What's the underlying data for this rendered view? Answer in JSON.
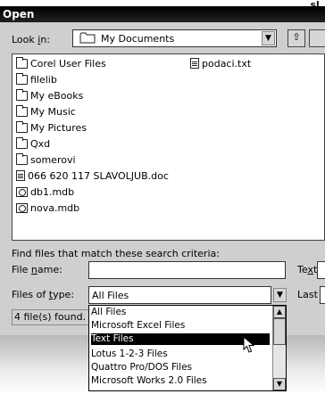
{
  "corner_text": "sl.",
  "window": {
    "title": "Open"
  },
  "look_in": {
    "label_pre": "Look ",
    "label_u": "i",
    "label_post": "n:",
    "value": "My Documents",
    "icon": "folder-icon"
  },
  "toolbar": {
    "up_icon": "up-folder-icon",
    "up_glyph": "⇧"
  },
  "files": [
    {
      "name": "Corel User Files",
      "icon": "folder-icon"
    },
    {
      "name": "filelib",
      "icon": "folder-icon"
    },
    {
      "name": "My eBooks",
      "icon": "folder-icon"
    },
    {
      "name": "My Music",
      "icon": "folder-icon"
    },
    {
      "name": "My Pictures",
      "icon": "folder-icon"
    },
    {
      "name": "Qxd",
      "icon": "folder-icon"
    },
    {
      "name": "somerovi",
      "icon": "folder-icon"
    },
    {
      "name": "066 620 117  SLAVOLJUB.doc",
      "icon": "word-doc-icon"
    },
    {
      "name": "db1.mdb",
      "icon": "access-db-icon"
    },
    {
      "name": "nova.mdb",
      "icon": "access-db-icon"
    },
    {
      "name": "podaci.txt",
      "icon": "text-file-icon"
    }
  ],
  "search": {
    "heading": "Find files that match these search criteria:",
    "file_name_pre": "File ",
    "file_name_u": "n",
    "file_name_post": "ame:",
    "file_name_value": "",
    "text_label_cut": "Te",
    "text_label_cut_u": "x",
    "text_label_cut_post": "t",
    "files_of_type_pre": "Files of ",
    "files_of_type_u": "t",
    "files_of_type_post": "ype:",
    "files_of_type_value": "All Files",
    "last_label_cut": "Last"
  },
  "status": {
    "text": "4 file(s) found."
  },
  "dropdown": {
    "options": [
      "All Files",
      "Microsoft Excel Files",
      "Text Files",
      "Lotus 1-2-3 Files",
      "Quattro Pro/DOS Files",
      "Microsoft Works 2.0 Files"
    ],
    "selected_index": 2
  }
}
